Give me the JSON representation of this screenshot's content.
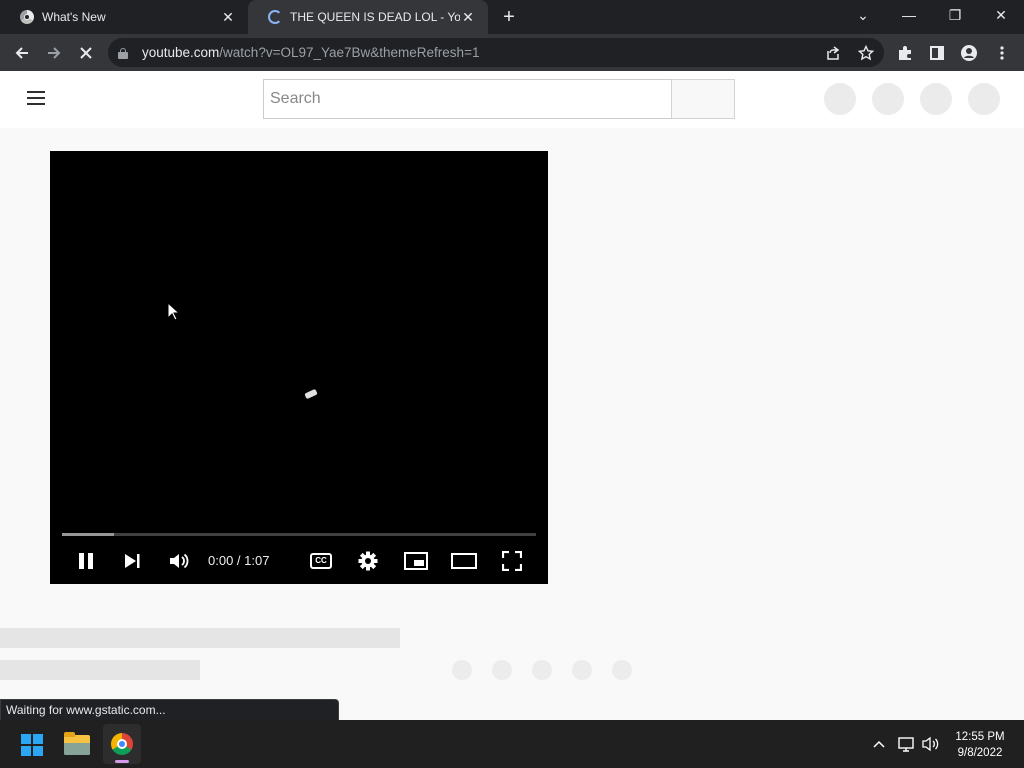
{
  "browser": {
    "tabs": [
      {
        "title": "What's New",
        "active": false
      },
      {
        "title": "THE QUEEN IS DEAD LOL - YouTube",
        "active": true,
        "loading": true
      }
    ],
    "new_tab_symbol": "+",
    "window_controls": {
      "tab_search": "⌄",
      "minimize": "—",
      "restore": "❐",
      "close": "✕"
    },
    "url_host": "youtube.com",
    "url_path": "/watch?v=OL97_Yae7Bw&themeRefresh=1",
    "status_text": "Waiting for www.gstatic.com..."
  },
  "youtube": {
    "search_placeholder": "Search"
  },
  "player": {
    "state": "playing",
    "current_time": "0:00",
    "duration": "1:07",
    "time_display": "0:00 / 1:07",
    "buffered_fraction": 0.11,
    "cc_label": "CC"
  },
  "taskbar": {
    "time": "12:55 PM",
    "date": "9/8/2022"
  },
  "colors": {
    "browser_dark": "#202124",
    "toolbar": "#35363a",
    "page_bg": "#f9f9f9",
    "player_bg": "#000000",
    "taskbar": "#202020"
  },
  "icons": [
    "chrome-icon",
    "loading-spinner-icon",
    "close-icon",
    "plus-icon",
    "back-arrow-icon",
    "forward-arrow-icon",
    "stop-icon",
    "lock-icon",
    "share-icon",
    "star-icon",
    "extensions-icon",
    "side-panel-icon",
    "profile-icon",
    "more-icon",
    "hamburger-icon",
    "pause-icon",
    "next-icon",
    "volume-icon",
    "cc-icon",
    "settings-icon",
    "miniplayer-icon",
    "theater-icon",
    "fullscreen-icon",
    "windows-start-icon",
    "file-explorer-icon",
    "chevron-up-icon",
    "network-icon",
    "speaker-icon"
  ]
}
